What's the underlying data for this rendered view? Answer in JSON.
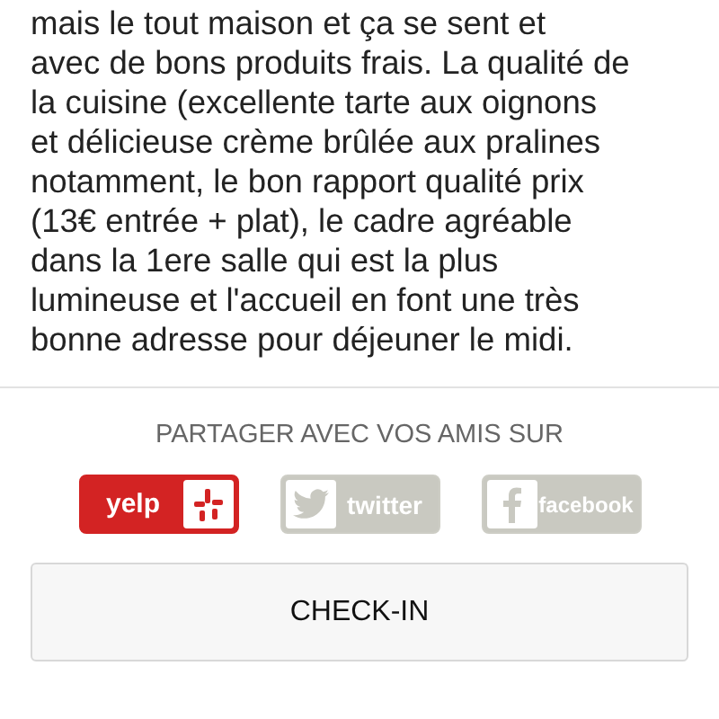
{
  "review": {
    "lines": [
      "mais le tout maison et ça se sent et",
      "avec de bons produits frais. La qualité de",
      "la cuisine (excellente tarte aux oignons",
      "et délicieuse crème brûlée aux pralines",
      "notamment, le bon rapport qualité prix",
      "(13€ entrée + plat), le cadre agréable",
      "dans la 1ere salle qui est la plus",
      "lumineuse et l'accueil en font une très",
      "bonne adresse pour déjeuner le midi."
    ]
  },
  "share": {
    "heading": "PARTAGER AVEC VOS AMIS SUR",
    "services": [
      {
        "kind": "yelp",
        "label": "yelp",
        "selected": true
      },
      {
        "kind": "twitter",
        "label": "twitter",
        "selected": false
      },
      {
        "kind": "facebook",
        "label": "facebook",
        "selected": false
      }
    ]
  },
  "checkin_button": "CHECK-IN"
}
